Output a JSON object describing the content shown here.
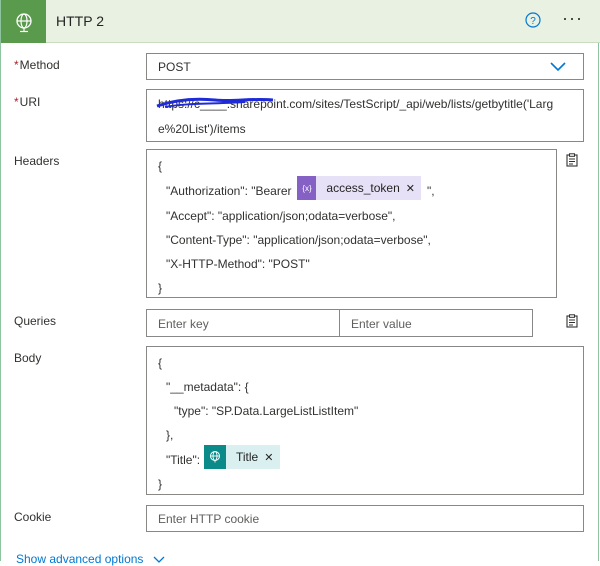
{
  "action": {
    "title": "HTTP 2"
  },
  "method": {
    "label": "Method",
    "required_marker": "*",
    "value": "POST"
  },
  "uri": {
    "label": "URI",
    "required_marker": "*",
    "line1": "https://c____.sharepoint.com/sites/TestScript/_api/web/lists/getbytitle('Larg",
    "line2": "e%20List')/items"
  },
  "headers": {
    "label": "Headers",
    "open": "{",
    "auth_prefix": "\"Authorization\": \"Bearer",
    "auth_suffix": "\",",
    "token": "access_token",
    "accept": "\"Accept\": \"application/json;odata=verbose\",",
    "content_type": "\"Content-Type\": \"application/json;odata=verbose\",",
    "x_http": "\"X-HTTP-Method\": \"POST\"",
    "close": "}"
  },
  "queries": {
    "label": "Queries",
    "key_placeholder": "Enter key",
    "value_placeholder": "Enter value"
  },
  "body": {
    "label": "Body",
    "open": "{",
    "metadata": "\"__metadata\": {",
    "type_line": "\"type\": \"SP.Data.LargeListListItem\"",
    "metadata_close": "},",
    "title_prefix": "\"Title\":",
    "token": "Title",
    "close": "}"
  },
  "cookie": {
    "label": "Cookie",
    "placeholder": "Enter HTTP cookie"
  },
  "advanced": {
    "label": "Show advanced options"
  },
  "colors": {
    "header_bg": "#e9f1e3",
    "header_icon": "#5a9a4d",
    "var_token": "#e7e1f7",
    "var_icon": "#8661c5",
    "field_token": "#d9eff0",
    "field_icon": "#0b8a8a",
    "link": "#0078d4",
    "required": "#a4262c"
  },
  "icons": {
    "action": "globe-icon",
    "help": "help-icon",
    "more": "more-icon",
    "dropdown": "chevron-down-icon",
    "clipboard": "clipboard-icon",
    "variable": "variable-icon"
  }
}
